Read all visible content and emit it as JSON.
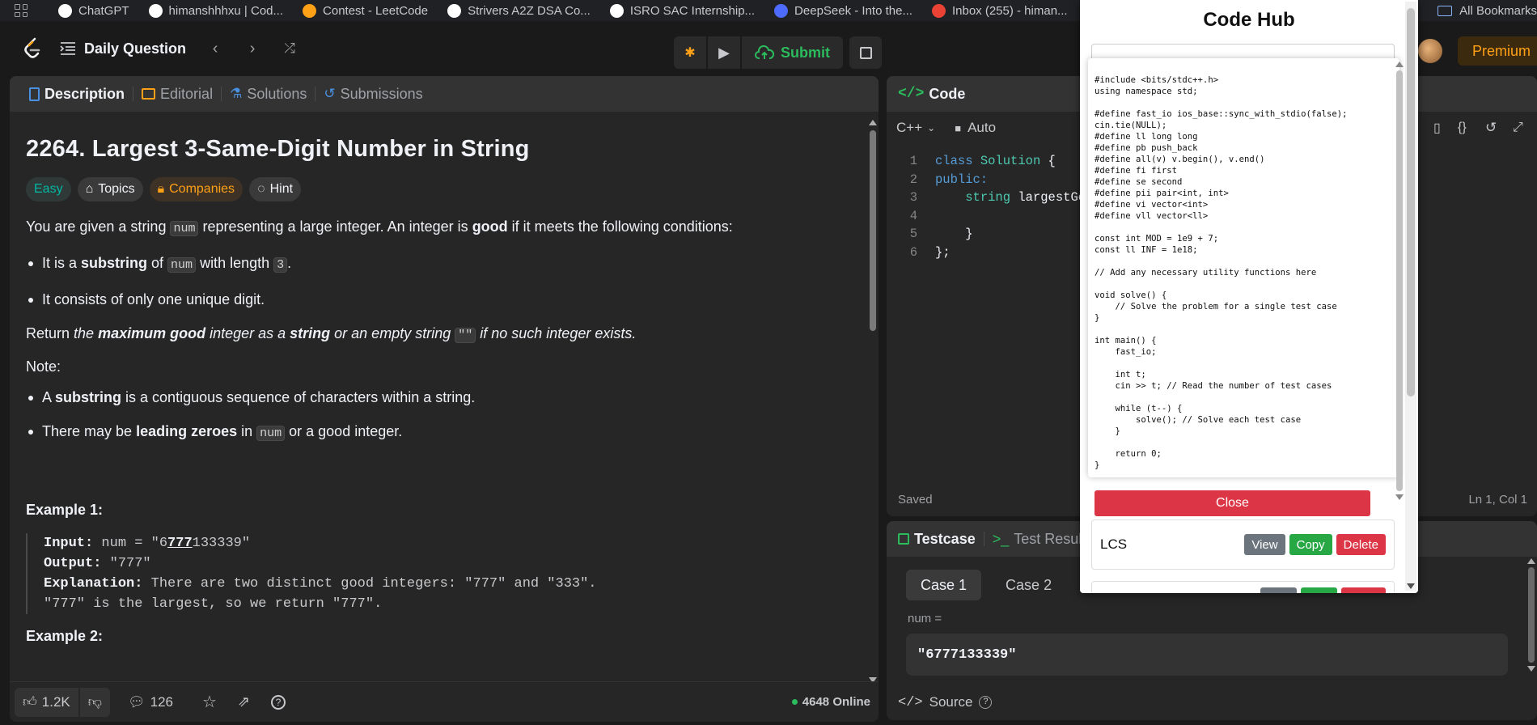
{
  "bookmarks": [
    {
      "label": "ChatGPT",
      "icon": "openai-icon",
      "color": "#ffffff"
    },
    {
      "label": "himanshhhxu | Cod...",
      "icon": "codechef-icon",
      "color": "#ffffff"
    },
    {
      "label": "Contest - LeetCode",
      "icon": "leetcode-icon",
      "color": "#ffa116"
    },
    {
      "label": "Strivers A2Z DSA Co...",
      "icon": "tuf-icon",
      "color": "#ffffff"
    },
    {
      "label": "ISRO SAC Internship...",
      "icon": "openai-icon",
      "color": "#ffffff"
    },
    {
      "label": "DeepSeek - Into the...",
      "icon": "deepseek-icon",
      "color": "#4d6bfe"
    },
    {
      "label": "Inbox (255) - himan...",
      "icon": "gmail-icon",
      "color": "#ea4335"
    }
  ],
  "bookmarks_all": "All Bookmarks",
  "header": {
    "title": "Daily Question",
    "submit": "Submit",
    "premium": "Premium"
  },
  "left_tabs": [
    "Description",
    "Editorial",
    "Solutions",
    "Submissions"
  ],
  "problem": {
    "title": "2264. Largest 3-Same-Digit Number in String",
    "chips": [
      "Easy",
      "Topics",
      "Companies",
      "Hint"
    ],
    "p1a": "You are given a string ",
    "p1code": "num",
    "p1b": " representing a large integer. An integer is ",
    "p1good": "good",
    "p1c": " if it meets the following conditions:",
    "b1a": "It is a ",
    "b1sub": "substring",
    "b1b": " of ",
    "b1code": "num",
    "b1c": " with length ",
    "b1len": "3",
    "b1d": ".",
    "b2": "It consists of only one unique digit.",
    "r1": "Return ",
    "r2": "the ",
    "r3": "maximum good",
    "r4": " integer as a ",
    "r5": "string",
    "r6": " or an empty string ",
    "r7": "\"\"",
    "r8": " if no such integer exists.",
    "note": "Note:",
    "n1a": "A ",
    "n1sub": "substring",
    "n1b": " is a contiguous sequence of characters within a string.",
    "n2a": "There may be ",
    "n2lz": "leading zeroes",
    "n2b": " in ",
    "n2code": "num",
    "n2c": " or a good integer.",
    "ex1_title": "Example 1:",
    "ex_input_label": "Input:",
    "ex_input_a": " num = \"6",
    "ex_input_u": "777",
    "ex_input_b": "133339\"",
    "ex_output_label": "Output:",
    "ex_output": " \"777\"",
    "ex_expl_label": "Explanation:",
    "ex_expl1": " There are two distinct good integers: \"777\" and \"333\".",
    "ex_expl2": "\"777\" is the largest, so we return \"777\".",
    "ex2_title": "Example 2:"
  },
  "footer": {
    "likes": "1.2K",
    "comments": "126",
    "online": "4648 Online"
  },
  "code_panel": {
    "title": "Code",
    "lang": "C++",
    "mode": "Auto",
    "status": "Saved",
    "cursor": "Ln 1, Col 1",
    "lines": [
      {
        "n": "1",
        "html": "class Solution {"
      },
      {
        "n": "2",
        "html": "public:"
      },
      {
        "n": "3",
        "html": "    string largestGo"
      },
      {
        "n": "4",
        "html": ""
      },
      {
        "n": "5",
        "html": "    }"
      },
      {
        "n": "6",
        "html": "};"
      }
    ]
  },
  "test_panel": {
    "tab1": "Testcase",
    "tab2": "Test Result",
    "case1": "Case 1",
    "case2": "Case 2",
    "var_label": "num =",
    "var_value": "\"6777133339\"",
    "source": "Source"
  },
  "codehub": {
    "title": "Code Hub",
    "code": "#include <bits/stdc++.h>\nusing namespace std;\n\n#define fast_io ios_base::sync_with_stdio(false);\ncin.tie(NULL);\n#define ll long long\n#define pb push_back\n#define all(v) v.begin(), v.end()\n#define fi first\n#define se second\n#define pii pair<int, int>\n#define vi vector<int>\n#define vll vector<ll>\n\nconst int MOD = 1e9 + 7;\nconst ll INF = 1e18;\n\n// Add any necessary utility functions here\n\nvoid solve() {\n    // Solve the problem for a single test case\n}\n\nint main() {\n    fast_io;\n\n    int t;\n    cin >> t; // Read the number of test cases\n\n    while (t--) {\n        solve(); // Solve each test case\n    }\n\n    return 0;\n}",
    "close": "Close",
    "item_name": "LCS",
    "view": "View",
    "copy": "Copy",
    "delete": "Delete"
  }
}
